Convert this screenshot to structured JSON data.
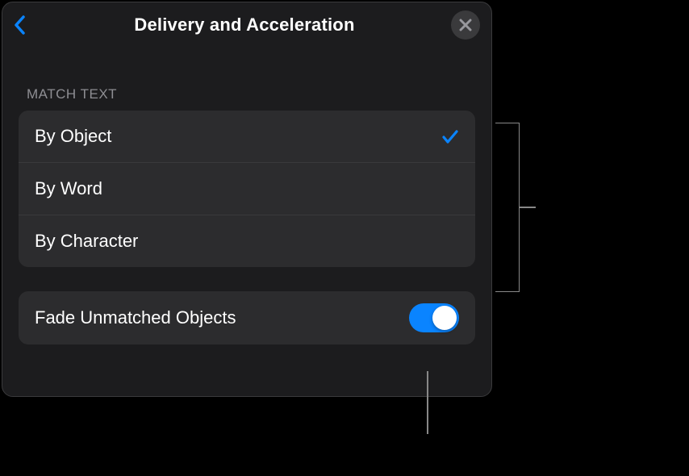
{
  "header": {
    "title": "Delivery and Acceleration"
  },
  "sections": {
    "matchText": {
      "header": "MATCH TEXT",
      "options": [
        {
          "label": "By Object",
          "selected": true
        },
        {
          "label": "By Word",
          "selected": false
        },
        {
          "label": "By Character",
          "selected": false
        }
      ]
    },
    "fadeUnmatched": {
      "label": "Fade Unmatched Objects",
      "value": true
    }
  }
}
